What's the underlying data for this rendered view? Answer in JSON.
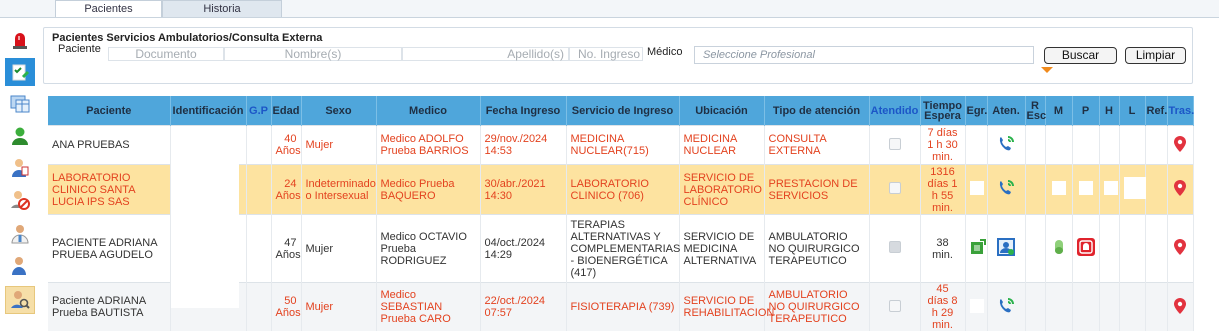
{
  "tabs": [
    "Pacientes",
    "Historia"
  ],
  "filter": {
    "title": "Pacientes Servicios Ambulatorios/Consulta Externa",
    "paciente_label": "Paciente",
    "medico_label": "Médico",
    "documento_placeholder": "Documento",
    "nombre_placeholder": "Nombre(s)",
    "apellido_placeholder": "Apellido(s)",
    "ingreso_placeholder": "No. Ingreso",
    "medico_placeholder": "Seleccione Profesional",
    "buscar_label": "Buscar",
    "limpiar_label": "Limpiar"
  },
  "columns": {
    "paciente": "Paciente",
    "identificacion": "Identificación",
    "gp": "G.P",
    "edad": "Edad",
    "sexo": "Sexo",
    "medico": "Medico",
    "fecha": "Fecha Ingreso",
    "servicio": "Servicio de Ingreso",
    "ubicacion": "Ubicación",
    "tipo": "Tipo de atención",
    "atendido": "Atendido",
    "tiempo1": "Tiempo",
    "tiempo2": "Espera",
    "egr": "Egr.",
    "aten": "Aten.",
    "resc1": "R",
    "resc2": "Esc",
    "m": "M",
    "p": "P",
    "h": "H",
    "l": "L",
    "ref": "Ref.",
    "tras": "Tras."
  },
  "rows": [
    {
      "paciente": "ANA PRUEBAS",
      "edad_num": "40",
      "edad_unit": "Años",
      "sexo": "Mujer",
      "medico": "Medico ADOLFO Prueba BARRIOS",
      "fecha": "29/nov./2024 14:53",
      "servicio": "MEDICINA NUCLEAR(715)",
      "ubicacion": "MEDICINA NUCLEAR",
      "tipo": "CONSULTA EXTERNA",
      "tiempo": "7 días 1 h 30 min."
    },
    {
      "paciente": "LABORATORIO CLINICO SANTA LUCIA IPS SAS",
      "edad_num": "24",
      "edad_unit": "Años",
      "sexo": "Indeterminado o Intersexual",
      "medico": "Medico Prueba BAQUERO",
      "fecha": "30/abr./2021 14:30",
      "servicio": "LABORATORIO CLINICO (706)",
      "ubicacion": "SERVICIO DE LABORATORIO CLÍNICO",
      "tipo": "PRESTACION DE SERVICIOS",
      "tiempo": "1316 días 1 h 55 min."
    },
    {
      "paciente": "PACIENTE ADRIANA PRUEBA AGUDELO",
      "edad_num": "47",
      "edad_unit": "Años",
      "sexo": "Mujer",
      "medico": "Medico OCTAVIO Prueba RODRIGUEZ",
      "fecha": "04/oct./2024 14:29",
      "servicio": "TERAPIAS ALTERNATIVAS Y COMPLEMENTARIAS - BIOENERGÉTICA (417)",
      "ubicacion": "SERVICIO DE MEDICINA ALTERNATIVA",
      "tipo": "AMBULATORIO NO QUIRURGICO TERAPEUTICO",
      "tiempo": "38 min."
    },
    {
      "paciente": "Paciente ADRIANA Prueba BAUTISTA",
      "edad_num": "50",
      "edad_unit": "Años",
      "sexo": "Mujer",
      "medico": "Medico SEBASTIAN Prueba CARO",
      "fecha": "22/oct./2024 07:57",
      "servicio": "FISIOTERAPIA (739)",
      "ubicacion": "SERVICIO DE REHABILITACION",
      "tipo": "AMBULATORIO NO QUIRURGICO TERAPEUTICO",
      "tiempo": "45 días 8 h 29 min."
    }
  ],
  "colors": {
    "header_bg": "#4fa6db",
    "row_highlight": "#fde3a0",
    "alert_red": "#e3421f",
    "link_blue": "#1c56c7"
  },
  "icons": [
    "alarm-icon",
    "checklist-icon",
    "grid-icon",
    "user-icon",
    "user-edit-icon",
    "user-stop-icon",
    "doctor-icon",
    "patient-icon",
    "patient-search-icon",
    "phone-call-icon",
    "location-pin-icon",
    "discharge-icon",
    "patient-card-icon",
    "pill-icon",
    "alert-box-icon"
  ]
}
